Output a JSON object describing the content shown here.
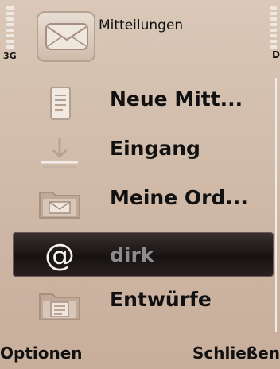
{
  "status": {
    "network": "3G",
    "right_indicator": "D"
  },
  "header": {
    "title": "Mitteilungen",
    "icon": "envelope-icon"
  },
  "menu": {
    "items": [
      {
        "label": "Neue Mitt...",
        "icon": "new-message-icon"
      },
      {
        "label": "Eingang",
        "icon": "inbox-icon"
      },
      {
        "label": "Meine Ord...",
        "icon": "folder-icon"
      },
      {
        "label": "dirk",
        "icon": "at-icon",
        "selected": true
      },
      {
        "label": "Entwürfe",
        "icon": "drafts-folder-icon"
      }
    ]
  },
  "softkeys": {
    "left": "Optionen",
    "right": "Schließen"
  }
}
